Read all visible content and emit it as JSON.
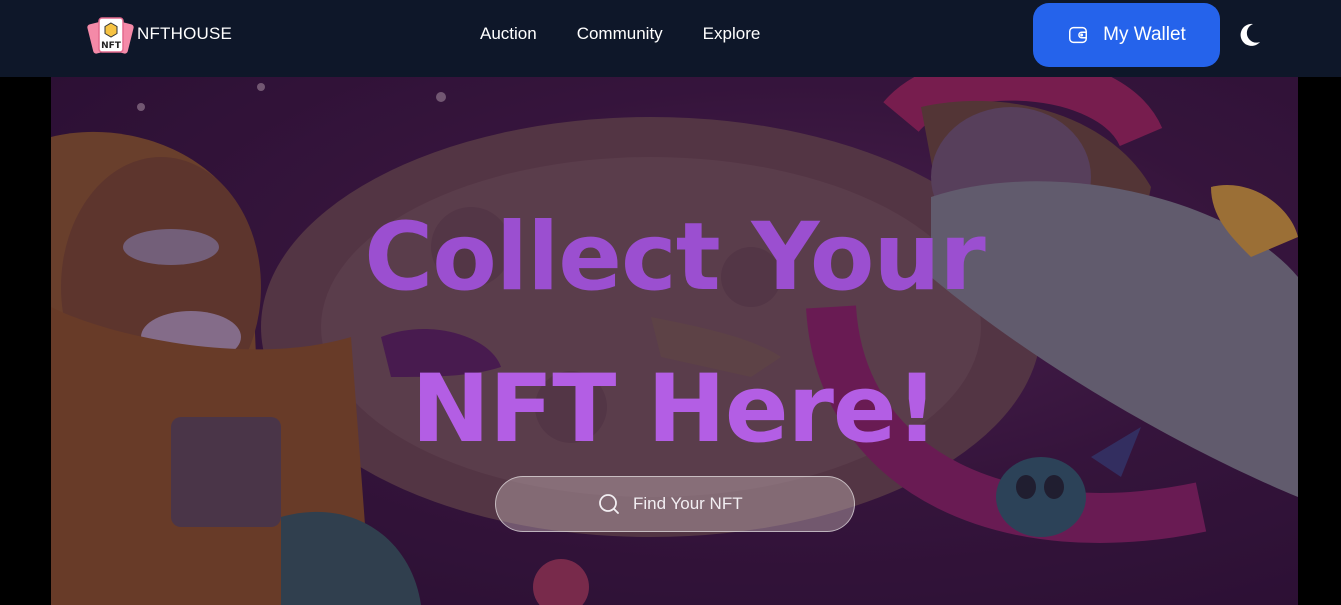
{
  "brand": {
    "name": "NFTHOUSE",
    "logo_icon": "nft-cards-logo-icon",
    "logo_text": "NFT"
  },
  "nav": {
    "links": [
      "Auction",
      "Community",
      "Explore"
    ]
  },
  "wallet": {
    "label": "My Wallet",
    "icon": "wallet-icon",
    "color": "#2563eb"
  },
  "theme_toggle": {
    "icon": "moon-icon"
  },
  "hero": {
    "title_line1": "Collect Your",
    "title_line2": "NFT Here!",
    "title_color": "#a458d8"
  },
  "search": {
    "placeholder": "Find Your NFT",
    "icon": "search-icon"
  },
  "colors": {
    "navbar_bg": "#0e1729",
    "hero_bg": "#3d1842"
  }
}
